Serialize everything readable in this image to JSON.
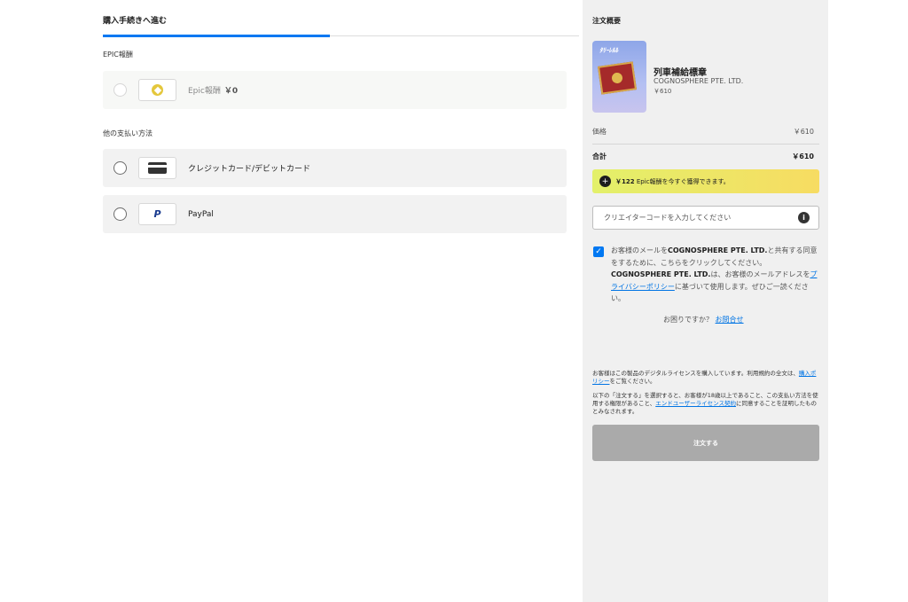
{
  "checkout": {
    "step_title": "購入手続きへ進む",
    "epic_section_label": "EPIC報酬",
    "epic_option": {
      "label": "Epic報酬",
      "amount": "￥0"
    },
    "other_section_label": "他の支払い方法",
    "methods": [
      {
        "label": "クレジットカード/デビットカード",
        "icon": "credit-card-icon"
      },
      {
        "label": "PayPal",
        "icon": "paypal-icon"
      }
    ]
  },
  "summary": {
    "title": "注文概要",
    "thumb_banner": "ﾀﾘｰﾚﾙﾙ",
    "product": {
      "name": "列車補給標章",
      "publisher": "COGNOSPHERE PTE. LTD.",
      "price": "￥610"
    },
    "price_label": "価格",
    "price_value": "￥610",
    "total_label": "合計",
    "total_value": "￥610",
    "reward_amount": "￥122",
    "reward_text": " Epic報酬を今すぐ獲得できます。",
    "creator_placeholder": "クリエイターコードを入力してください",
    "consent": {
      "part1": "お客様のメールを",
      "company1": "COGNOSPHERE PTE. LTD.",
      "part2": "と共有する同意をするために、こちらをクリックしてください。",
      "company2": "COGNOSPHERE PTE. LTD.",
      "part3": "は、お客様のメールアドレスを",
      "privacy_link": "プライバシーポリシー",
      "part4": "に基づいて使用します。ぜひご一読ください。"
    },
    "help_text": "お困りですか？",
    "help_link": "お問合せ",
    "legal1_part1": "お客様はこの製品のデジタルライセンスを購入しています。利用規約の全文は、",
    "legal1_link": "購入ポリシー",
    "legal1_part2": "をご覧ください。",
    "legal2_part1": "以下の「注文する」を選択すると、お客様が18歳以上であること、この支払い方法を使用する権限があること、",
    "legal2_link": "エンドユーザーライセンス契約",
    "legal2_part2": "に同意することを証明したものとみなされます。",
    "order_button": "注文する"
  },
  "colors": {
    "accent": "#0078f2",
    "sidebar_bg": "#f0f0f0",
    "option_bg": "#f2f2f2",
    "order_button_disabled": "#aaaaaa",
    "reward_gradient_start": "#e3f06a",
    "reward_gradient_end": "#f7dc62"
  }
}
